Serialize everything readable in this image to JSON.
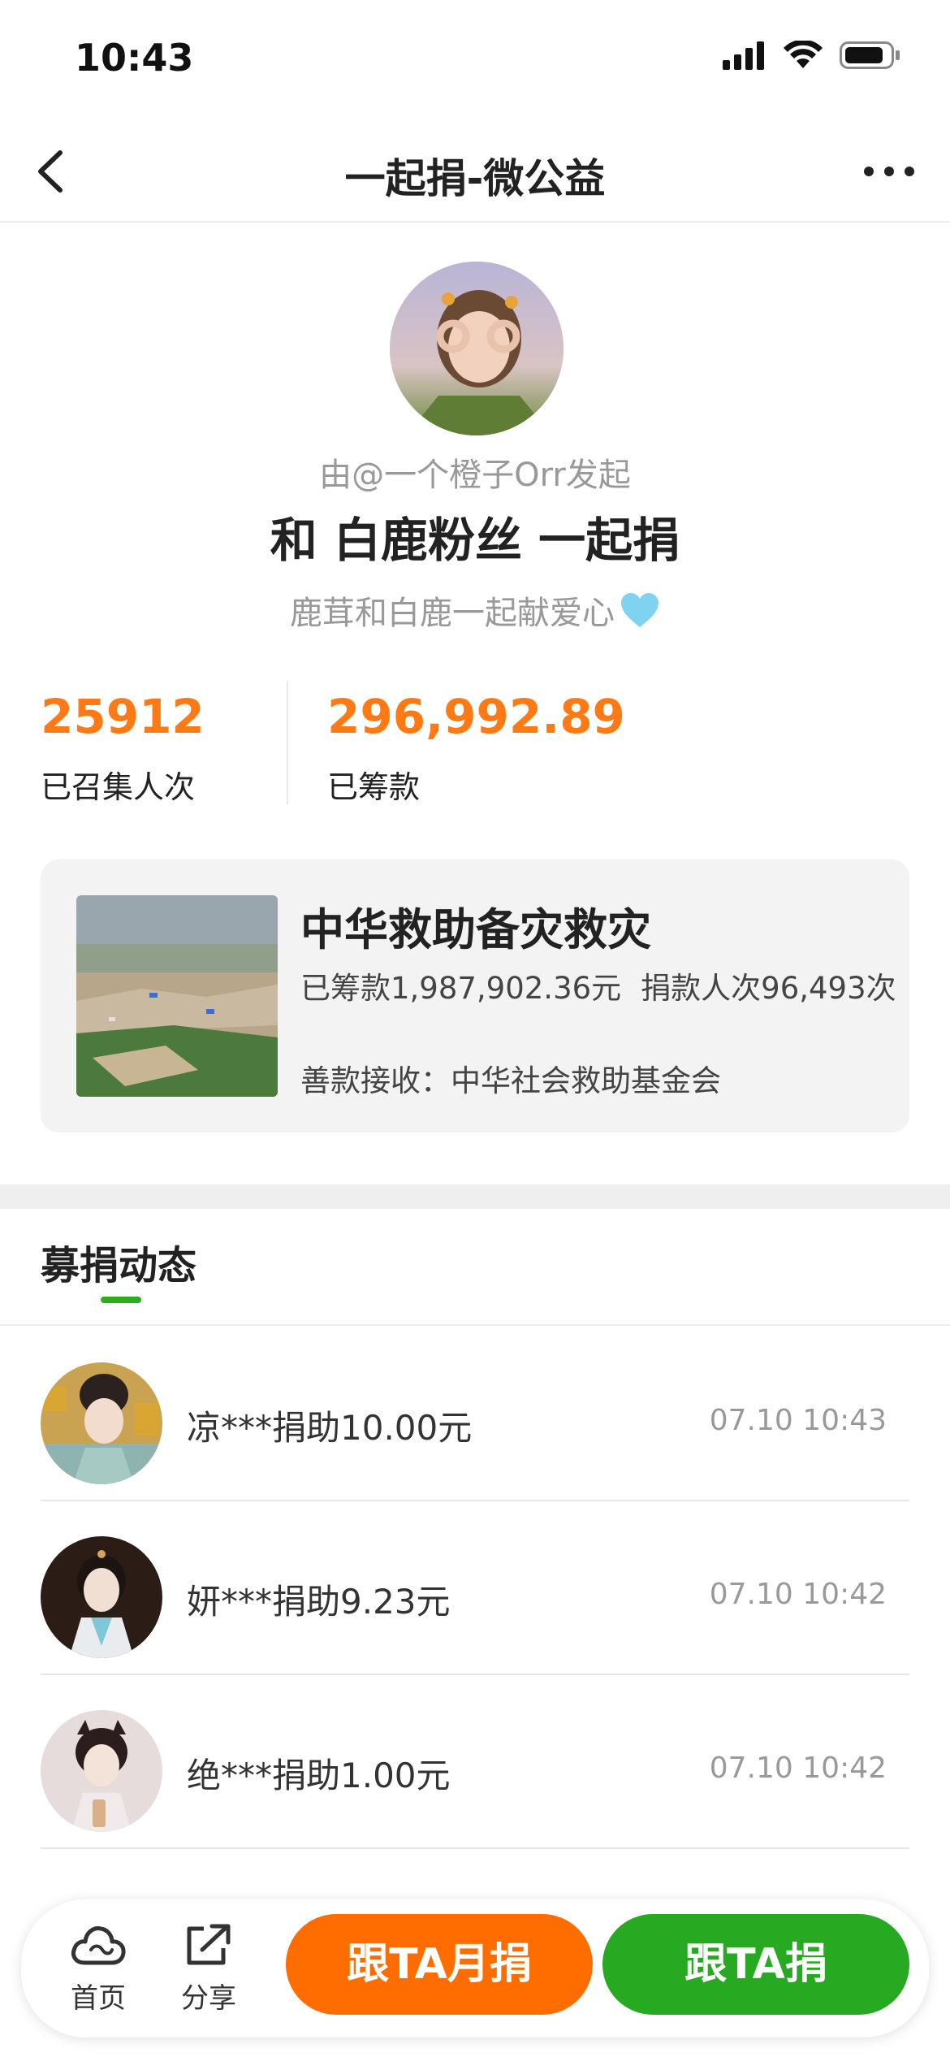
{
  "status_bar": {
    "time": "10:43"
  },
  "nav": {
    "title": "一起捐-微公益"
  },
  "campaign": {
    "initiator": "由@一个橙子Orr发起",
    "title": "和 白鹿粉丝 一起捐",
    "description": "鹿茸和白鹿一起献爱心",
    "description_emoji": "light-blue-heart-icon"
  },
  "stats": {
    "participants_value": "25912",
    "participants_label": "已召集人次",
    "raised_value": "296,992.89",
    "raised_label": "已筹款"
  },
  "project": {
    "name": "中华救助备灾救灾",
    "raised": "已筹款1,987,902.36元",
    "donors": "捐款人次96,493次",
    "receiver": "善款接收：中华社会救助基金会"
  },
  "tabs": {
    "active": "募捐动态"
  },
  "donations": [
    {
      "text": "凉***捐助10.00元",
      "time": "07.10 10:43"
    },
    {
      "text": "妍***捐助9.23元",
      "time": "07.10 10:42"
    },
    {
      "text": "绝***捐助1.00元",
      "time": "07.10 10:42"
    }
  ],
  "bottom_bar": {
    "home_label": "首页",
    "share_label": "分享",
    "monthly_button": "跟TA月捐",
    "donate_button": "跟TA捐"
  },
  "colors": {
    "accent_orange": "#ff7a14",
    "button_orange": "#ff6d00",
    "button_green": "#27aa22",
    "tab_indicator": "#2aae1f"
  }
}
